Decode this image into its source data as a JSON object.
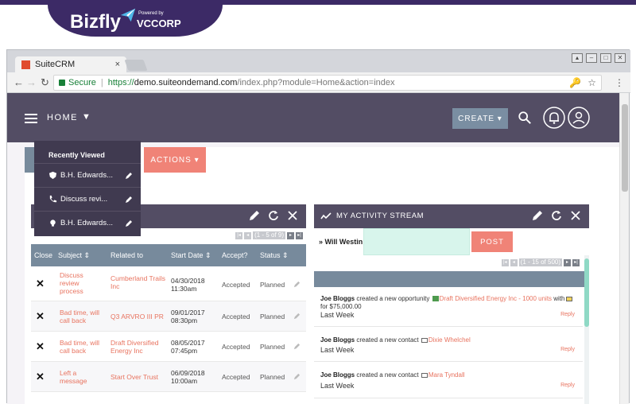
{
  "brand": {
    "name": "Bizfly",
    "powered_by": "Powered by",
    "partner": "VCCORP"
  },
  "browser": {
    "tab_title": "SuiteCRM",
    "tab_close": "×",
    "secure_label": "Secure",
    "url_scheme": "https://",
    "url_host": "demo.suiteondemand.com",
    "url_path": "/index.php?module=Home&action=index"
  },
  "header": {
    "home_label": "HOME",
    "create_label": "CREATE"
  },
  "actions_label": "ACTIONS",
  "recently_viewed": {
    "title": "Recently Viewed",
    "items": [
      {
        "label": "B.H. Edwards...",
        "icon": "shield-icon"
      },
      {
        "label": "Discuss revi...",
        "icon": "phone-icon"
      },
      {
        "label": "B.H. Edwards...",
        "icon": "bulb-icon"
      }
    ]
  },
  "calls_dashlet": {
    "pager_text": "(1 - 5 of 9)",
    "columns": [
      "Close",
      "Subject",
      "Related to",
      "Start Date",
      "Accept?",
      "Status"
    ],
    "rows": [
      {
        "subject": "Discuss review process",
        "related": "Cumberland Trails Inc",
        "date": "04/30/2018",
        "time": "11:30am",
        "accept": "Accepted",
        "status": "Planned"
      },
      {
        "subject": "Bad time, will call back",
        "related": "Q3 ARVRO III PR",
        "date": "09/01/2017",
        "time": "08:30pm",
        "accept": "Accepted",
        "status": "Planned"
      },
      {
        "subject": "Bad time, will call back",
        "related": "Draft Diversified Energy Inc",
        "date": "08/05/2017",
        "time": "07:45pm",
        "accept": "Accepted",
        "status": "Planned"
      },
      {
        "subject": "Left a message",
        "related": "Start Over Trust",
        "date": "06/09/2018",
        "time": "10:00am",
        "accept": "Accepted",
        "status": "Planned"
      }
    ]
  },
  "activity_stream": {
    "title": "MY ACTIVITY STREAM",
    "user_label": "Will Westin",
    "post_label": "POST",
    "pager_text": "(1 - 15 of 500)",
    "feed": [
      {
        "actor": "Joe Bloggs",
        "verb": " created a new opportunity ",
        "link": "Draft Diversified Energy Inc - 1000 units",
        "suffix": " with",
        "extra": "for $75,000.00",
        "when": "Last Week",
        "reply": "Reply"
      },
      {
        "actor": "Joe Bloggs",
        "verb": " created a new contact ",
        "link": "Dixie Whelchel",
        "suffix": "",
        "extra": "",
        "when": "Last Week",
        "reply": "Reply"
      },
      {
        "actor": "Joe Bloggs",
        "verb": " created a new contact ",
        "link": "Mara Tyndall",
        "suffix": "",
        "extra": "",
        "when": "Last Week",
        "reply": "Reply"
      }
    ]
  },
  "colors": {
    "header": "#534d64",
    "accent": "#f08377",
    "table_head": "#778a9c"
  }
}
